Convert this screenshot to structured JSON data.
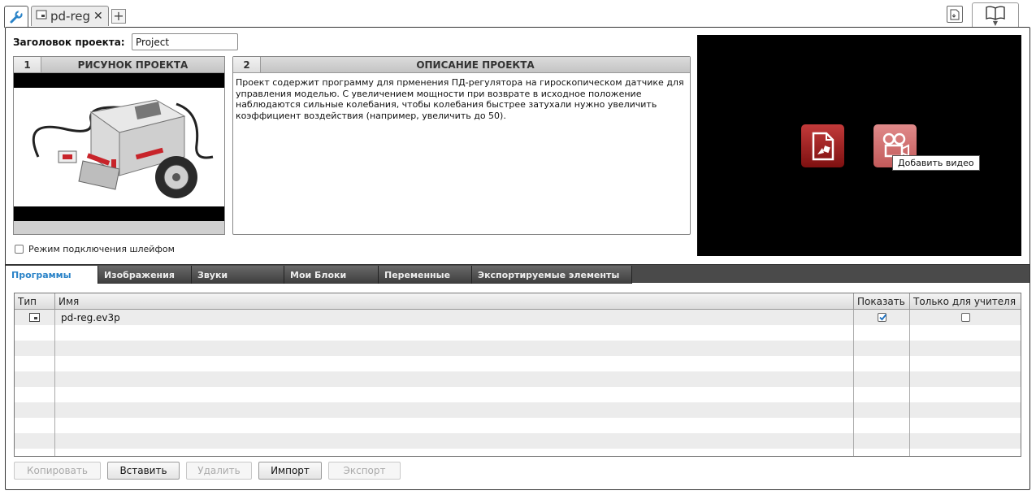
{
  "tabs": {
    "file_tab_label": "pd-reg"
  },
  "project": {
    "title_label": "Заголовок проекта:",
    "title_value": "Project",
    "picture_panel": {
      "number": "1",
      "title": "РИСУНОК ПРОЕКТА"
    },
    "description_panel": {
      "number": "2",
      "title": "ОПИСАНИЕ ПРОЕКТА",
      "text": "Проект содержит программу для прменения ПД-регулятора на гироскопическом датчике для управления моделью. С увеличением мощности при возврате в исходное положение наблюдаются сильные колебания, чтобы колебания быстрее затухали нужно увеличить коэффициент воздействия (например, увеличить до 50)."
    },
    "daisy_chain_label": "Режим подключения шлейфом",
    "daisy_chain_checked": false
  },
  "media": {
    "tooltip": "Добавить видео"
  },
  "bottom_tabs": [
    {
      "label": "Программы",
      "active": true
    },
    {
      "label": "Изображения",
      "active": false
    },
    {
      "label": "Звуки",
      "active": false
    },
    {
      "label": "Мои Блоки",
      "active": false
    },
    {
      "label": "Переменные",
      "active": false
    },
    {
      "label": "Экспортируемые элементы",
      "active": false
    }
  ],
  "table": {
    "columns": [
      "Тип",
      "Имя",
      "Показать",
      "Только для учителя"
    ],
    "rows": [
      {
        "type_icon": "program-icon",
        "name": "pd-reg.ev3p",
        "show": true,
        "teacher_only": false
      }
    ]
  },
  "actions": {
    "copy": "Копировать",
    "paste": "Вставить",
    "delete": "Удалить",
    "import": "Импорт",
    "export": "Экспорт",
    "disabled": [
      "copy",
      "delete",
      "export"
    ]
  }
}
